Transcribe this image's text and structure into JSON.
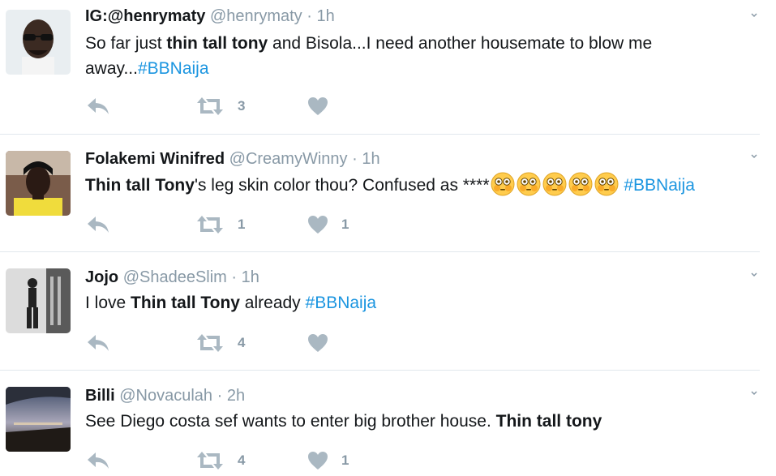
{
  "tweets": [
    {
      "name": "IG:@henrymaty",
      "handle": "@henrymaty",
      "dot": "·",
      "time": "1h",
      "text_parts": [
        {
          "t": "So far just ",
          "s": "normal"
        },
        {
          "t": "thin tall tony",
          "s": "bold"
        },
        {
          "t": " and Bisola...I need another housemate to blow me away...",
          "s": "normal"
        },
        {
          "t": "#BBNaija",
          "s": "hashtag"
        }
      ],
      "retweets": "3",
      "likes": ""
    },
    {
      "name": "Folakemi Winifred",
      "handle": "@CreamyWinny",
      "dot": "·",
      "time": "1h",
      "text_parts": [
        {
          "t": "Thin tall Tony",
          "s": "bold"
        },
        {
          "t": "'s leg skin color thou? Confused as ****",
          "s": "normal"
        },
        {
          "t": "flushed-face",
          "s": "emoji"
        },
        {
          "t": "flushed-face",
          "s": "emoji"
        },
        {
          "t": "flushed-face",
          "s": "emoji"
        },
        {
          "t": "flushed-face",
          "s": "emoji"
        },
        {
          "t": "flushed-face",
          "s": "emoji"
        },
        {
          "t": " ",
          "s": "normal"
        },
        {
          "t": "#BBNaija",
          "s": "hashtag"
        }
      ],
      "retweets": "1",
      "likes": "1"
    },
    {
      "name": "Jojo",
      "handle": "@ShadeeSlim",
      "dot": "·",
      "time": "1h",
      "text_parts": [
        {
          "t": "I love ",
          "s": "normal"
        },
        {
          "t": "Thin tall Tony",
          "s": "bold"
        },
        {
          "t": " already ",
          "s": "normal"
        },
        {
          "t": "#BBNaija",
          "s": "hashtag"
        }
      ],
      "retweets": "4",
      "likes": ""
    },
    {
      "name": "Billi",
      "handle": "@Novaculah",
      "dot": "·",
      "time": "2h",
      "text_parts": [
        {
          "t": "See Diego costa sef wants to enter big brother house. ",
          "s": "normal"
        },
        {
          "t": "Thin tall tony",
          "s": "bold"
        }
      ],
      "retweets": "4",
      "likes": "1"
    }
  ],
  "icons": {
    "reply": "reply-icon",
    "retweet": "retweet-icon",
    "like": "heart-icon",
    "caret": "chevron-down-icon"
  },
  "colors": {
    "hashtag": "#1b95e0",
    "muted": "#8899a6",
    "action": "#aab8c2",
    "divider": "#e1e8ed"
  }
}
